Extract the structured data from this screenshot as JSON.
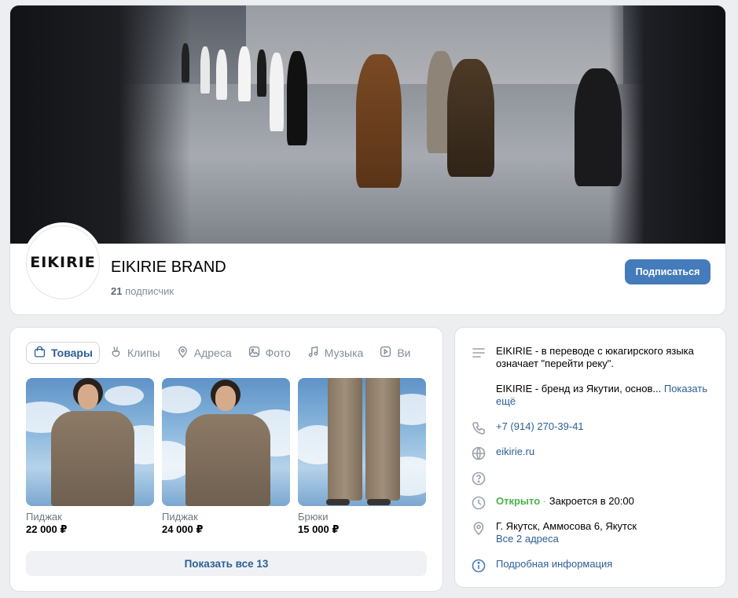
{
  "header": {
    "group_name": "EIKIRIE BRAND",
    "avatar_logo": "EIKIRIE",
    "subscribers_count": "21",
    "subscribers_label": "подписчик",
    "subscribe_button": "Подписаться"
  },
  "market": {
    "tabs": [
      {
        "label": "Товары",
        "icon": "shopping-bag-icon",
        "active": true
      },
      {
        "label": "Клипы",
        "icon": "clips-icon",
        "active": false
      },
      {
        "label": "Адреса",
        "icon": "location-pin-icon",
        "active": false
      },
      {
        "label": "Фото",
        "icon": "photo-icon",
        "active": false
      },
      {
        "label": "Музыка",
        "icon": "music-note-icon",
        "active": false
      },
      {
        "label": "Ви",
        "icon": "video-icon",
        "active": false
      }
    ],
    "products": [
      {
        "name": "Пиджак",
        "price": "22 000 ₽"
      },
      {
        "name": "Пиджак",
        "price": "24 000 ₽"
      },
      {
        "name": "Брюки",
        "price": "15 000 ₽"
      }
    ],
    "show_all": "Показать все 13"
  },
  "info": {
    "description_line1": "EIKIRIE - в переводе с юкагирского языка означает \"перейти реку\".",
    "description_line2": "EIKIRIE - бренд из Якутии, основ...",
    "show_more": "Показать ещё",
    "phone": "+7 (914) 270-39-41",
    "website": "eikirie.ru",
    "status_open": "Открыто",
    "status_separator": "·",
    "closes_at": "Закроется в 20:00",
    "address": "Г. Якутск, Аммосова 6, Якутск",
    "all_addresses": "Все 2 адреса",
    "more_info": "Подробная информация"
  },
  "colors": {
    "accent": "#447bba",
    "link": "#2c5f96",
    "open_status": "#4bb34b",
    "background": "#edeef0"
  }
}
